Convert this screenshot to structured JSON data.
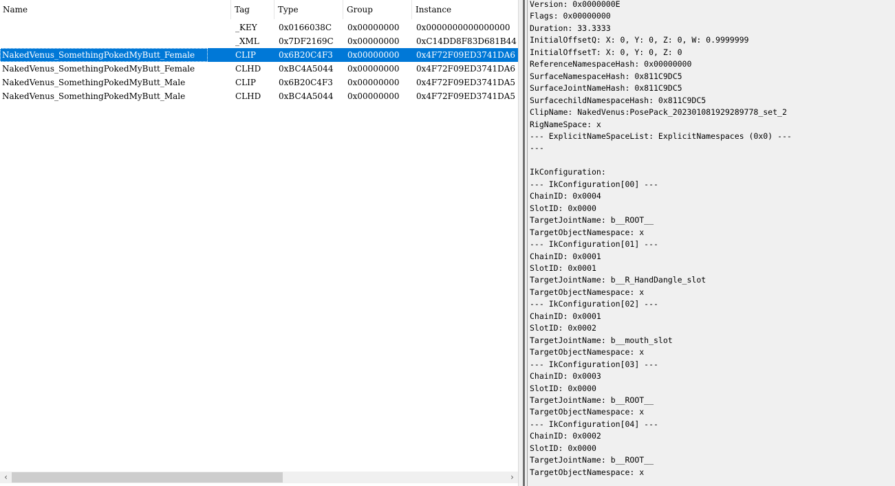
{
  "list": {
    "columns": [
      "Name",
      "Tag",
      "Type",
      "Group",
      "Instance"
    ],
    "rows": [
      {
        "name": "",
        "tag": "_KEY",
        "type": "0x0166038C",
        "group": "0x00000000",
        "instance": "0x0000000000000000"
      },
      {
        "name": "",
        "tag": "_XML",
        "type": "0x7DF2169C",
        "group": "0x00000000",
        "instance": "0xC14DD8F83D681B44"
      },
      {
        "name": "NakedVenus_SomethingPokedMyButt_Female",
        "tag": "CLIP",
        "type": "0x6B20C4F3",
        "group": "0x00000000",
        "instance": "0x4F72F09ED3741DA6",
        "selected": true
      },
      {
        "name": "NakedVenus_SomethingPokedMyButt_Female",
        "tag": "CLHD",
        "type": "0xBC4A5044",
        "group": "0x00000000",
        "instance": "0x4F72F09ED3741DA6"
      },
      {
        "name": "NakedVenus_SomethingPokedMyButt_Male",
        "tag": "CLIP",
        "type": "0x6B20C4F3",
        "group": "0x00000000",
        "instance": "0x4F72F09ED3741DA5"
      },
      {
        "name": "NakedVenus_SomethingPokedMyButt_Male",
        "tag": "CLHD",
        "type": "0xBC4A5044",
        "group": "0x00000000",
        "instance": "0x4F72F09ED3741DA5"
      }
    ],
    "selected_color": "#0078d7"
  },
  "scrollbar": {
    "left_icon": "chevron-left-icon",
    "right_icon": "chevron-right-icon",
    "left_glyph": "‹",
    "right_glyph": "›"
  },
  "details": {
    "lines": [
      "Version: 0x0000000E",
      "Flags: 0x00000000",
      "Duration: 33.3333",
      "InitialOffsetQ: X: 0, Y: 0, Z: 0, W: 0.9999999",
      "InitialOffsetT: X: 0, Y: 0, Z: 0",
      "ReferenceNamespaceHash: 0x00000000",
      "SurfaceNamespaceHash: 0x811C9DC5",
      "SurfaceJointNameHash: 0x811C9DC5",
      "SurfacechildNamespaceHash: 0x811C9DC5",
      "ClipName: NakedVenus:PosePack_202301081929289778_set_2",
      "RigNameSpace: x",
      "--- ExplicitNameSpaceList: ExplicitNamespaces (0x0) ---",
      "---",
      "",
      "IkConfiguration:",
      "--- IkConfiguration[00] ---",
      "ChainID: 0x0004",
      "SlotID: 0x0000",
      "TargetJointName: b__ROOT__",
      "TargetObjectNamespace: x",
      "--- IkConfiguration[01] ---",
      "ChainID: 0x0001",
      "SlotID: 0x0001",
      "TargetJointName: b__R_HandDangle_slot",
      "TargetObjectNamespace: x",
      "--- IkConfiguration[02] ---",
      "ChainID: 0x0001",
      "SlotID: 0x0002",
      "TargetJointName: b__mouth_slot",
      "TargetObjectNamespace: x",
      "--- IkConfiguration[03] ---",
      "ChainID: 0x0003",
      "SlotID: 0x0000",
      "TargetJointName: b__ROOT__",
      "TargetObjectNamespace: x",
      "--- IkConfiguration[04] ---",
      "ChainID: 0x0002",
      "SlotID: 0x0000",
      "TargetJointName: b__ROOT__",
      "TargetObjectNamespace: x"
    ]
  }
}
